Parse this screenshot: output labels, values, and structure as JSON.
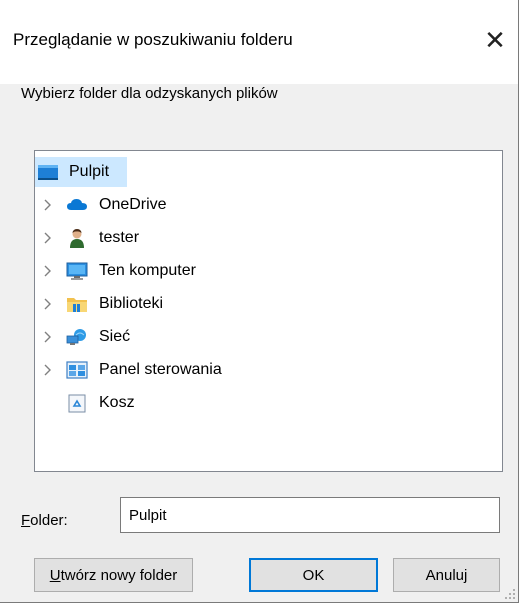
{
  "window": {
    "title": "Przeglądanie w poszukiwaniu folderu",
    "close_glyph": "✕"
  },
  "instruction": "Wybierz folder dla odzyskanych plików",
  "tree": {
    "items": [
      {
        "label": "Pulpit",
        "icon": "desktop-icon",
        "expandable": false,
        "selected": true
      },
      {
        "label": "OneDrive",
        "icon": "cloud-icon",
        "expandable": true
      },
      {
        "label": "tester",
        "icon": "user-icon",
        "expandable": true
      },
      {
        "label": "Ten komputer",
        "icon": "computer-icon",
        "expandable": true
      },
      {
        "label": "Biblioteki",
        "icon": "libraries-icon",
        "expandable": true
      },
      {
        "label": "Sieć",
        "icon": "network-icon",
        "expandable": true
      },
      {
        "label": "Panel sterowania",
        "icon": "control-panel-icon",
        "expandable": true
      },
      {
        "label": "Kosz",
        "icon": "recycle-bin-icon",
        "expandable": false
      }
    ]
  },
  "folder_field": {
    "label_prefix": "F",
    "label_rest": "older:",
    "value": "Pulpit"
  },
  "buttons": {
    "new_folder_prefix": "U",
    "new_folder_rest": "twórz nowy folder",
    "ok": "OK",
    "cancel": "Anuluj"
  },
  "colors": {
    "selection": "#cce8ff",
    "default_button_border": "#0078d7",
    "dialog_bg": "#f0f0f0"
  }
}
